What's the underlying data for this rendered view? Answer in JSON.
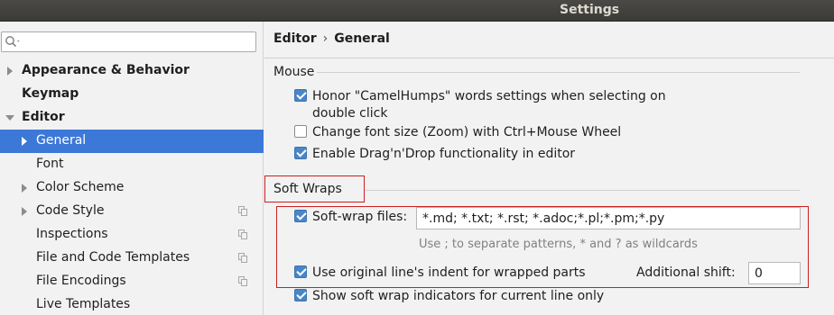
{
  "window": {
    "title": "Settings"
  },
  "search": {
    "placeholder": "",
    "value": ""
  },
  "sidebar": {
    "items": [
      {
        "label": "Appearance & Behavior",
        "bold": true,
        "arrow": "right",
        "level": 0
      },
      {
        "label": "Keymap",
        "bold": true,
        "arrow": "none",
        "level": 0
      },
      {
        "label": "Editor",
        "bold": true,
        "arrow": "down",
        "level": 0
      },
      {
        "label": "General",
        "bold": false,
        "arrow": "right",
        "level": 1,
        "selected": true
      },
      {
        "label": "Font",
        "bold": false,
        "arrow": "none",
        "level": 1
      },
      {
        "label": "Color Scheme",
        "bold": false,
        "arrow": "right",
        "level": 1
      },
      {
        "label": "Code Style",
        "bold": false,
        "arrow": "right",
        "level": 1,
        "copy_icon": true
      },
      {
        "label": "Inspections",
        "bold": false,
        "arrow": "none",
        "level": 1,
        "copy_icon": true
      },
      {
        "label": "File and Code Templates",
        "bold": false,
        "arrow": "none",
        "level": 1,
        "copy_icon": true
      },
      {
        "label": "File Encodings",
        "bold": false,
        "arrow": "none",
        "level": 1,
        "copy_icon": true
      },
      {
        "label": "Live Templates",
        "bold": false,
        "arrow": "none",
        "level": 1
      }
    ]
  },
  "breadcrumb": {
    "parent": "Editor",
    "separator": "›",
    "current": "General"
  },
  "mouse": {
    "title": "Mouse",
    "options": [
      {
        "label_line1": "Honor \"CamelHumps\" words settings when selecting on",
        "label_line2": "double click",
        "checked": true
      },
      {
        "label_line1": "Change font size (Zoom) with Ctrl+Mouse Wheel",
        "checked": false
      },
      {
        "label_line1": "Enable Drag'n'Drop functionality in editor",
        "checked": true
      }
    ]
  },
  "soft_wraps": {
    "title": "Soft Wraps",
    "soft_wrap_files": {
      "label": "Soft-wrap files:",
      "checked": true,
      "value": "*.md; *.txt; *.rst; *.adoc;*.pl;*.pm;*.py"
    },
    "hint": "Use ; to separate patterns, * and ? as wildcards",
    "use_original_indent": {
      "label": "Use original line's indent for wrapped parts",
      "checked": true
    },
    "additional_shift": {
      "label": "Additional shift:",
      "value": "0"
    },
    "show_indicators": {
      "label": "Show soft wrap indicators for current line only",
      "checked": true
    }
  },
  "colors": {
    "selection": "#3c78d8",
    "checkbox": "#4a86c7",
    "highlight_box": "#cc1f1f"
  }
}
